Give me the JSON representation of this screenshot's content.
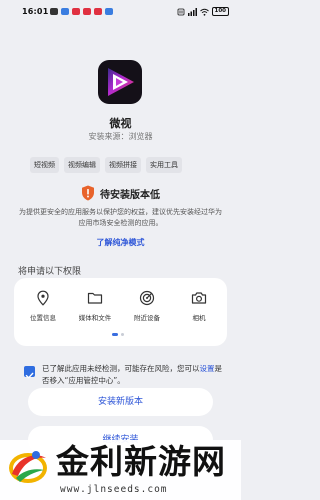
{
  "status_bar": {
    "time": "16:01",
    "battery": "100"
  },
  "app": {
    "name": "微视",
    "install_source": "安装来源：浏览器"
  },
  "tags": [
    "短视频",
    "视频编辑",
    "视频拼接",
    "实用工具"
  ],
  "warning": {
    "title": "待安装版本低",
    "description": "为提供更安全的应用服务以保护您的权益，建议优先安装经过华为应用市场安全检测的应用。",
    "link": "了解纯净模式"
  },
  "permissions": {
    "title": "将申请以下权限",
    "items": [
      {
        "label": "位置信息",
        "icon": "location-icon"
      },
      {
        "label": "媒体和文件",
        "icon": "folder-icon"
      },
      {
        "label": "附近设备",
        "icon": "nearby-devices-icon"
      },
      {
        "label": "相机",
        "icon": "camera-icon"
      }
    ]
  },
  "acknowledge": {
    "text_before": "已了解此应用未经检测，可能存在风险，您可以",
    "link": "设置",
    "text_after": "是否移入“应用管控中心”。",
    "checked": true
  },
  "buttons": {
    "install": "安装新版本",
    "continue": "继续安装"
  },
  "watermark": {
    "title": "金利新游网",
    "url": "www.jlnseeds.com"
  },
  "colors": {
    "accent": "#2f57d8",
    "warning": "#e8632b",
    "background": "#eeeff3"
  }
}
